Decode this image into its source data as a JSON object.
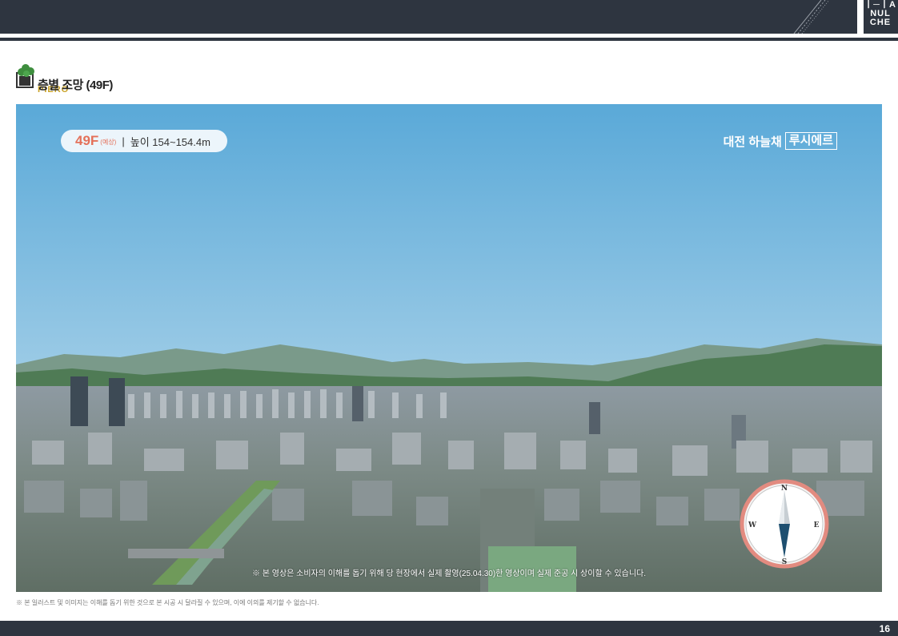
{
  "brand": {
    "logo_lines": [
      "ㅣ─ㅣA",
      "NUL",
      "CHE"
    ]
  },
  "section": {
    "title": "층별 조망 (49F)",
    "subtitle": "PIERO"
  },
  "photo": {
    "floor": "49F",
    "floor_note": "(예상)",
    "separator": "|",
    "height": "높이 154~154.4m",
    "watermark_a": "대전 하늘채",
    "watermark_b": "루시에르",
    "compass": {
      "n": "N",
      "s": "S",
      "e": "E",
      "w": "W"
    },
    "video_note": "※ 본 영상은 소비자의 이해를 돕기 위해 당 현장에서 실제 촬영(25.04.30)한 영상이며 실제 준공 시 상이할 수 있습니다."
  },
  "footnote": "※ 본 일러스트 및 이미지는 이해를 돕기 위한 것으로 본 시공 시 달라질 수 있으며, 이에 이의를 제기할 수 없습니다.",
  "page_number": "16",
  "colors": {
    "dark_bar": "#2e3540",
    "accent": "#e4715a",
    "gold": "#c9a227"
  }
}
